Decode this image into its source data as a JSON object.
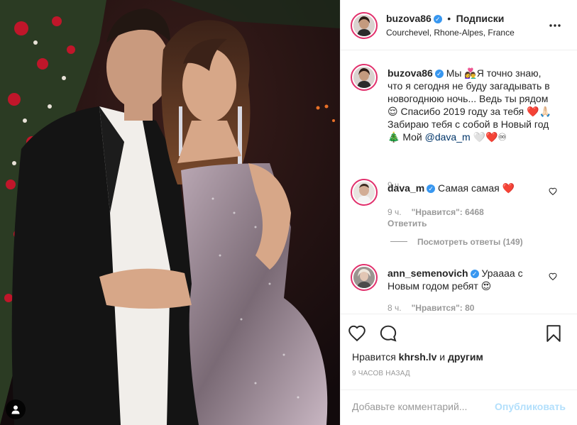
{
  "post": {
    "username": "buzova86",
    "separator": "•",
    "follow_status": "Подписки",
    "location": "Courchevel, Rhone-Alpes, France",
    "more_icon": "more-horizontal-icon"
  },
  "caption": {
    "username": "buzova86",
    "text_1": "Мы 👩‍❤️‍👨Я точно знаю, что я сегодня не буду загадывать в новогоднюю ночь... Ведь ты рядом 😌 Спасибо 2019 году за тебя ❤️🙏🏻 Забираю тебя с собой в Новый год 🎄 Мой ",
    "mention": "@dava_m",
    "text_2": " 🤍❤️♾",
    "time": "9 ч."
  },
  "comments": [
    {
      "username": "dava_m",
      "text": "Самая самая ❤️",
      "time": "9 ч.",
      "likes": "\"Нравится\": 6468",
      "reply": "Ответить",
      "view_replies": "Посмотреть ответы (149)"
    },
    {
      "username": "ann_semenovich",
      "text": "Ураааа с Новым годом ребят 😍",
      "time": "8 ч.",
      "likes": "\"Нравится\": 80"
    }
  ],
  "actions": {
    "liked_by_prefix": "Нравится",
    "liked_by_user": "khrsh.lv",
    "liked_by_and": "и",
    "liked_by_others": "другим",
    "timestamp": "9 ЧАСОВ НАЗАД"
  },
  "comment_box": {
    "placeholder": "Добавьте комментарий...",
    "publish": "Опубликовать"
  },
  "colors": {
    "link": "#003569",
    "verified": "#3897f0",
    "publish_disabled": "#b2dffc",
    "muted": "#8e8e8e"
  }
}
